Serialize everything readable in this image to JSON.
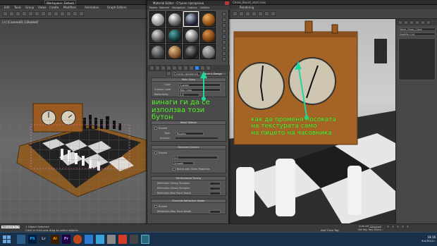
{
  "main_window": {
    "title": "Chess_Board_start.max",
    "workspace": "Workspace: Default",
    "menus": [
      "Edit",
      "Tools",
      "Group",
      "Views",
      "Create",
      "Modifiers",
      "Animation",
      "Graph Editors",
      "Rendering"
    ]
  },
  "viewport_left": {
    "label": "[+] [Camera01] [Shaded]"
  },
  "material_editor": {
    "title": "Material Editor - Стъкло прозрачно",
    "menus": [
      "Modes",
      "Material",
      "Navigation",
      "Options",
      "Utilities"
    ],
    "material_name": "Стъкло прозрачно",
    "material_type": "Arch & Design",
    "rollouts": {
      "main_glass": {
        "header": "Main Glass",
        "color_label": "Color",
        "color_value": "Custom",
        "custom_color_label": "Custom Color",
        "custom_color_value": "Max Color",
        "reflect_label": "Reflectivity",
        "reflect_value": "0.8"
      },
      "relief_pattern": {
        "header": "Relief Pattern",
        "enable_label": "Enable",
        "type_label": "Type",
        "type_value": "Ripples",
        "amount_label": "Amount"
      },
      "rounded_corners": {
        "header": "Rounded Corners",
        "enable_label": "Enable",
        "radius_value": "0.0",
        "smooth_label": "Smooth",
        "blend_label": "Blend with Other Materials"
      },
      "performance": {
        "header": "Performance Tuning",
        "rows": [
          "Reflection Glossy Samples",
          "Reflection Glossy Samples",
          "Reflection Max Trace Depth"
        ]
      },
      "override": {
        "header": "Override Refraction Depth",
        "enable_label": "Enable",
        "depth_label": "Refraction Max Trace Depth"
      }
    }
  },
  "command_panel": {
    "object_name": "Mesh_Glass_Clock",
    "modifier_list": "Modifier List"
  },
  "annotations": {
    "left": [
      "винаги ги да се",
      "използва този",
      "бутон"
    ],
    "right": [
      "как да променя посоката",
      "на текстурата само",
      "на пицето на часовника"
    ]
  },
  "status": {
    "welcome": "Welcome to M",
    "selection": "1 Object Selected",
    "prompt": "Click or click-and-drag to select objects",
    "add_time_tag": "Add Time Tag",
    "auto_key": "Auto Key",
    "selected": "Selected",
    "set_key": "Set Key",
    "key_filters": "Key Filters..."
  },
  "taskbar": {
    "apps": [
      "PS",
      "Lr",
      "Ai",
      "Pr"
    ],
    "time": "18:16",
    "date": "6.4.2014 г."
  },
  "colors": {
    "annotation": "#5df03a",
    "arrow": "#1fd6a0",
    "taskbar": "#19304a"
  }
}
